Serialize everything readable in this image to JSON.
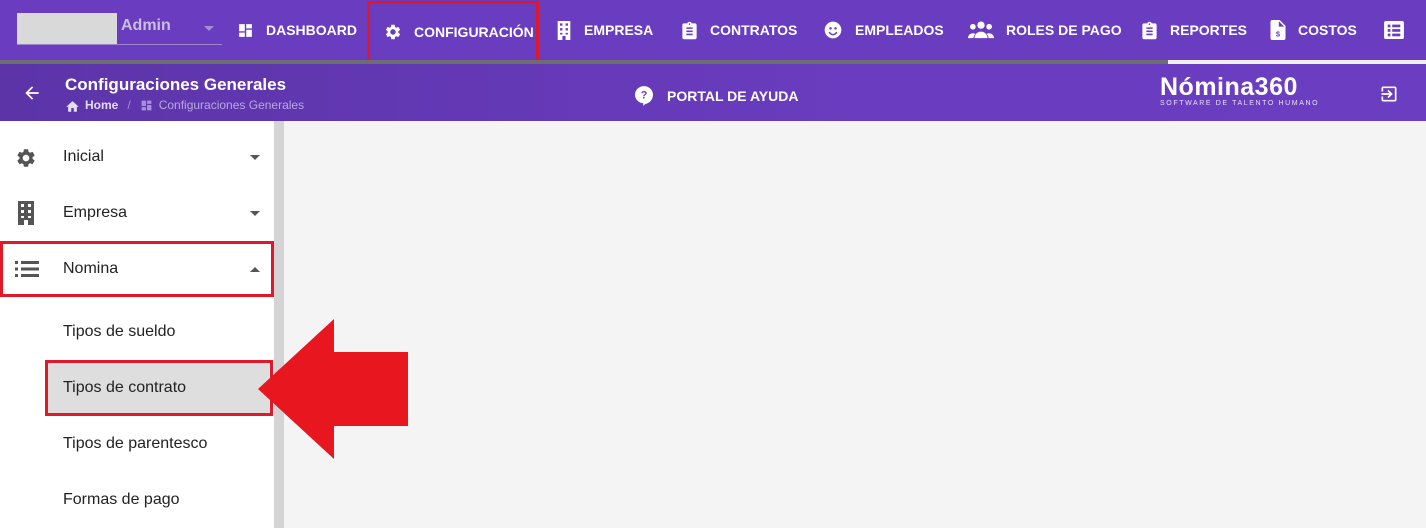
{
  "user": {
    "name": "Admin"
  },
  "nav": {
    "items": [
      {
        "label": "DASHBOARD",
        "icon": "dashboard-icon"
      },
      {
        "label": "CONFIGURACIÓN",
        "icon": "gear-icon"
      },
      {
        "label": "EMPRESA",
        "icon": "building-icon"
      },
      {
        "label": "CONTRATOS",
        "icon": "clipboard-icon"
      },
      {
        "label": "EMPLEADOS",
        "icon": "face-icon"
      },
      {
        "label": "ROLES DE PAGO",
        "icon": "people-icon"
      },
      {
        "label": "REPORTES",
        "icon": "clipboard-icon"
      },
      {
        "label": "COSTOS",
        "icon": "invoice-icon"
      }
    ],
    "highlighted": "CONFIGURACIÓN"
  },
  "header": {
    "title": "Configuraciones Generales",
    "breadcrumb": {
      "home": "Home",
      "current": "Configuraciones Generales"
    },
    "help_label": "PORTAL DE AYUDA",
    "logo_main": "Nómina360",
    "logo_sub": "SOFTWARE DE TALENTO HUMANO"
  },
  "sidebar": {
    "items": [
      {
        "label": "Inicial",
        "icon": "gear-icon",
        "expanded": false
      },
      {
        "label": "Empresa",
        "icon": "building-icon",
        "expanded": false
      },
      {
        "label": "Nomina",
        "icon": "list-icon",
        "expanded": true
      }
    ],
    "subitems": [
      {
        "label": "Tipos de sueldo"
      },
      {
        "label": "Tipos de contrato",
        "active": true
      },
      {
        "label": "Tipos de parentesco"
      },
      {
        "label": "Formas de pago"
      }
    ]
  },
  "colors": {
    "primary": "#6a3cbf",
    "highlight": "#e0192a",
    "background": "#f4f4f4"
  }
}
